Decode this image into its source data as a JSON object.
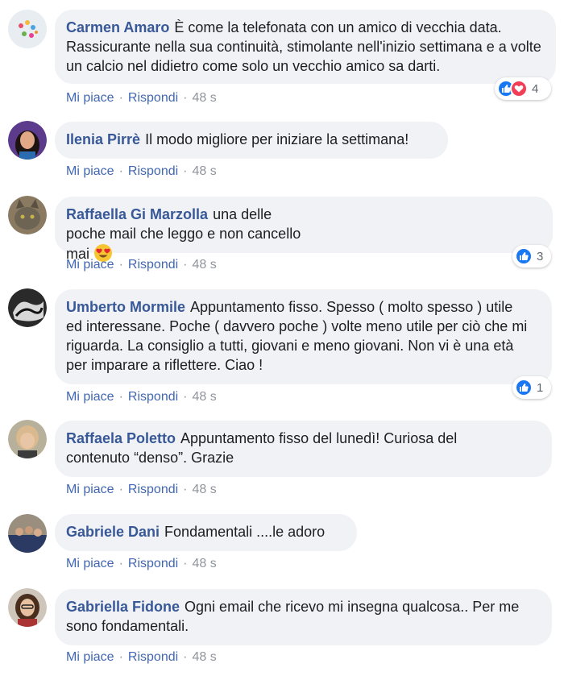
{
  "labels": {
    "like": "Mi piace",
    "reply": "Rispondi",
    "separator": "·"
  },
  "colors": {
    "author": "#385898",
    "link": "#4267b2",
    "bubble": "#f0f2f5",
    "meta": "#90949c",
    "like_blue": "#1877f2",
    "love_red": "#f33e58"
  },
  "comments": [
    {
      "author": "Carmen Amaro",
      "text": "È come la telefonata con un amico di vecchia data. Rassicurante nella sua continuità, stimolante nell'inizio settimana e a volte un calcio nel didietro come solo un vecchio amico sa darti.",
      "time": "48 s",
      "reactions": {
        "icons": [
          "like-icon",
          "love-icon"
        ],
        "count": "4"
      }
    },
    {
      "author": "Ilenia Pirrè",
      "text": "Il modo migliore per iniziare la settimana!",
      "time": "48 s"
    },
    {
      "author": "Raffaella Gi Marzolla",
      "text": "una delle poche mail che leggo e non cancello mai",
      "emoji": "heart-eyes-emoji",
      "time": "48 s",
      "reactions": {
        "icons": [
          "like-icon"
        ],
        "count": "3"
      }
    },
    {
      "author": "Umberto Mormile",
      "text": "Appuntamento fisso. Spesso ( molto spesso ) utile ed interessane. Poche ( davvero poche ) volte meno utile per ciò che mi riguarda. La consiglio a tutti, giovani e meno giovani. Non vi è una età per imparare a riflettere. Ciao !",
      "time": "48 s",
      "reactions": {
        "icons": [
          "like-icon"
        ],
        "count": "1"
      }
    },
    {
      "author": "Raffaela Poletto",
      "text": "Appuntamento fisso del lunedì! Curiosa del contenuto “denso”. Grazie",
      "time": "48 s"
    },
    {
      "author": "Gabriele Dani",
      "text": "Fondamentali ....le adoro",
      "time": "48 s"
    },
    {
      "author": "Gabriella Fidone",
      "text": "Ogni email che ricevo mi insegna qualcosa.. Per me sono fondamentali.",
      "time": "48 s"
    }
  ]
}
